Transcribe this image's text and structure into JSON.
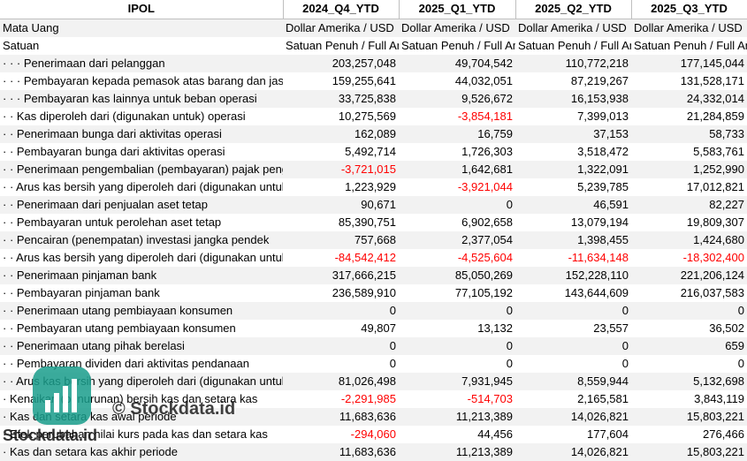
{
  "header": {
    "company": "IPOL",
    "periods": [
      "2024_Q4_YTD",
      "2025_Q1_YTD",
      "2025_Q2_YTD",
      "2025_Q3_YTD"
    ]
  },
  "meta_rows": [
    {
      "label": "Mata Uang",
      "values": [
        "Dollar Amerika / USD",
        "Dollar Amerika / USD",
        "Dollar Amerika / USD",
        "Dollar Amerika / USD"
      ]
    },
    {
      "label": "Satuan",
      "values": [
        "Satuan Penuh / Full Amount",
        "Satuan Penuh / Full Amount",
        "Satuan Penuh / Full Amount",
        "Satuan Penuh / Full Amount"
      ]
    }
  ],
  "rows": [
    {
      "label": "· · · Penerimaan dari pelanggan",
      "values": [
        "203,257,048",
        "49,704,542",
        "110,772,218",
        "177,145,044"
      ],
      "neg": [
        false,
        false,
        false,
        false
      ]
    },
    {
      "label": "· · · Pembayaran kepada pemasok atas barang dan jasa",
      "values": [
        "159,255,641",
        "44,032,051",
        "87,219,267",
        "131,528,171"
      ],
      "neg": [
        false,
        false,
        false,
        false
      ]
    },
    {
      "label": "· · · Pembayaran kas lainnya untuk beban operasi",
      "values": [
        "33,725,838",
        "9,526,672",
        "16,153,938",
        "24,332,014"
      ],
      "neg": [
        false,
        false,
        false,
        false
      ]
    },
    {
      "label": "· · Kas diperoleh dari (digunakan untuk) operasi",
      "values": [
        "10,275,569",
        "-3,854,181",
        "7,399,013",
        "21,284,859"
      ],
      "neg": [
        false,
        true,
        false,
        false
      ]
    },
    {
      "label": "· · Penerimaan bunga dari aktivitas operasi",
      "values": [
        "162,089",
        "16,759",
        "37,153",
        "58,733"
      ],
      "neg": [
        false,
        false,
        false,
        false
      ]
    },
    {
      "label": "· · Pembayaran bunga dari aktivitas operasi",
      "values": [
        "5,492,714",
        "1,726,303",
        "3,518,472",
        "5,583,761"
      ],
      "neg": [
        false,
        false,
        false,
        false
      ]
    },
    {
      "label": "· · Penerimaan pengembalian (pembayaran) pajak penghasilan",
      "values": [
        "-3,721,015",
        "1,642,681",
        "1,322,091",
        "1,252,990"
      ],
      "neg": [
        true,
        false,
        false,
        false
      ]
    },
    {
      "label": "· · Arus kas bersih yang diperoleh dari (digunakan untuk) aktivitas operasi",
      "values": [
        "1,223,929",
        "-3,921,044",
        "5,239,785",
        "17,012,821"
      ],
      "neg": [
        false,
        true,
        false,
        false
      ]
    },
    {
      "label": "· · Penerimaan dari penjualan aset tetap",
      "values": [
        "90,671",
        "0",
        "46,591",
        "82,227"
      ],
      "neg": [
        false,
        false,
        false,
        false
      ]
    },
    {
      "label": "· · Pembayaran untuk perolehan aset tetap",
      "values": [
        "85,390,751",
        "6,902,658",
        "13,079,194",
        "19,809,307"
      ],
      "neg": [
        false,
        false,
        false,
        false
      ]
    },
    {
      "label": "· · Pencairan (penempatan) investasi jangka pendek",
      "values": [
        "757,668",
        "2,377,054",
        "1,398,455",
        "1,424,680"
      ],
      "neg": [
        false,
        false,
        false,
        false
      ]
    },
    {
      "label": "· · Arus kas bersih yang diperoleh dari (digunakan untuk) aktivitas investasi",
      "values": [
        "-84,542,412",
        "-4,525,604",
        "-11,634,148",
        "-18,302,400"
      ],
      "neg": [
        true,
        true,
        true,
        true
      ]
    },
    {
      "label": "· · Penerimaan pinjaman bank",
      "values": [
        "317,666,215",
        "85,050,269",
        "152,228,110",
        "221,206,124"
      ],
      "neg": [
        false,
        false,
        false,
        false
      ]
    },
    {
      "label": "· · Pembayaran pinjaman bank",
      "values": [
        "236,589,910",
        "77,105,192",
        "143,644,609",
        "216,037,583"
      ],
      "neg": [
        false,
        false,
        false,
        false
      ]
    },
    {
      "label": "· · Penerimaan utang pembiayaan konsumen",
      "values": [
        "0",
        "0",
        "0",
        "0"
      ],
      "neg": [
        false,
        false,
        false,
        false
      ]
    },
    {
      "label": "· · Pembayaran utang pembiayaan konsumen",
      "values": [
        "49,807",
        "13,132",
        "23,557",
        "36,502"
      ],
      "neg": [
        false,
        false,
        false,
        false
      ]
    },
    {
      "label": "· · Penerimaan utang pihak berelasi",
      "values": [
        "0",
        "0",
        "0",
        "659"
      ],
      "neg": [
        false,
        false,
        false,
        false
      ]
    },
    {
      "label": "· · Pembayaran dividen dari aktivitas pendanaan",
      "values": [
        "0",
        "0",
        "0",
        "0"
      ],
      "neg": [
        false,
        false,
        false,
        false
      ]
    },
    {
      "label": "· · Arus kas bersih yang diperoleh dari (digunakan untuk) aktivitas pendanaan",
      "values": [
        "81,026,498",
        "7,931,945",
        "8,559,944",
        "5,132,698"
      ],
      "neg": [
        false,
        false,
        false,
        false
      ]
    },
    {
      "label": "· Kenaikan (penurunan) bersih kas dan setara kas",
      "values": [
        "-2,291,985",
        "-514,703",
        "2,165,581",
        "3,843,119"
      ],
      "neg": [
        true,
        true,
        false,
        false
      ]
    },
    {
      "label": "· Kas dan setara kas awal periode",
      "values": [
        "11,683,636",
        "11,213,389",
        "14,026,821",
        "15,803,221"
      ],
      "neg": [
        false,
        false,
        false,
        false
      ]
    },
    {
      "label": "· Efek perubahan nilai kurs pada kas dan setara kas",
      "values": [
        "-294,060",
        "44,456",
        "177,604",
        "276,466"
      ],
      "neg": [
        true,
        false,
        false,
        false
      ]
    },
    {
      "label": "· Kas dan setara kas akhir periode",
      "values": [
        "11,683,636",
        "11,213,389",
        "14,026,821",
        "15,803,221"
      ],
      "neg": [
        false,
        false,
        false,
        false
      ]
    }
  ],
  "watermark": {
    "text1": "© Stockdata.id",
    "text2": "Stockdata.id",
    "color": "#1a9e8c"
  }
}
